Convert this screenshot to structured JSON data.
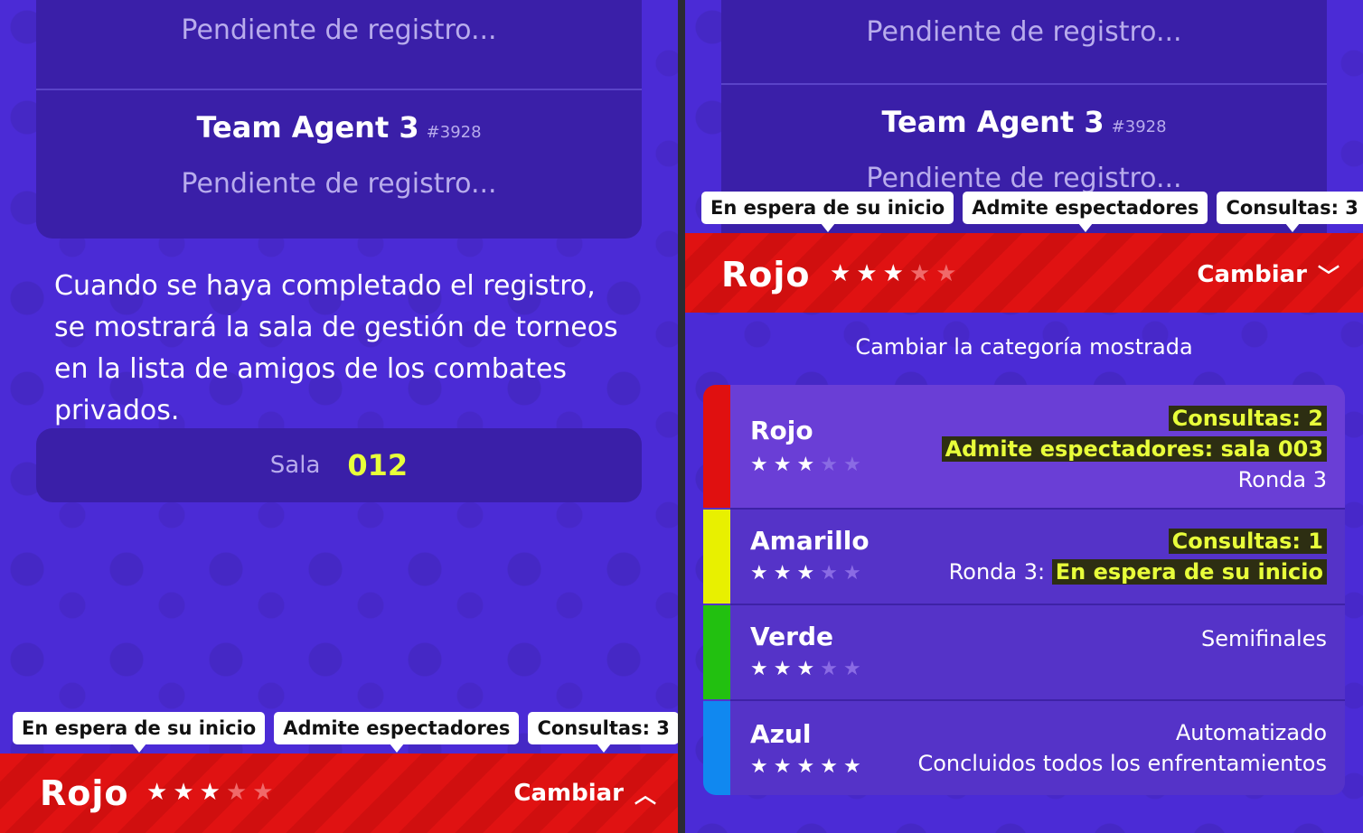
{
  "left": {
    "pending_1": "Pendiente de registro...",
    "team_name": "Team Agent 3",
    "team_code": "#3928",
    "pending_2": "Pendiente de registro...",
    "info": "Cuando se haya completado el registro, se mostrará la sala de gestión de torneos en la lista de amigos de los combates privados.",
    "sala_label": "Sala",
    "sala_value": "012",
    "tags": [
      "En espera de su inicio",
      "Admite espectadores",
      "Consultas: 3"
    ],
    "bar_team": "Rojo",
    "bar_stars": 3,
    "bar_stars_total": 5,
    "cambiar": "Cambiar",
    "cambiar_icon": "chevron-up-icon"
  },
  "right": {
    "pending_1": "Pendiente de registro...",
    "team_name": "Team Agent 3",
    "team_code": "#3928",
    "pending_2": "Pendiente de registro...",
    "tags": [
      "En espera de su inicio",
      "Admite espectadores",
      "Consultas: 3"
    ],
    "bar_team": "Rojo",
    "bar_stars": 3,
    "bar_stars_total": 5,
    "cambiar": "Cambiar",
    "cambiar_icon": "chevron-down-icon",
    "category_title": "Cambiar la categoría mostrada",
    "categories": [
      {
        "name": "Rojo",
        "color": "#e01010",
        "stars": 3,
        "line1": "Consultas: 2",
        "line2": "Admite espectadores: sala 003",
        "line3": "Ronda 3"
      },
      {
        "name": "Amarillo",
        "color": "#e8f000",
        "stars": 3,
        "line1": "Consultas: 1",
        "line2_prefix": "Ronda 3:",
        "line2": "En espera de su inicio"
      },
      {
        "name": "Verde",
        "color": "#22c010",
        "stars": 3,
        "line1": "Semifinales"
      },
      {
        "name": "Azul",
        "color": "#1088f0",
        "stars": 5,
        "line1": "Automatizado",
        "line2": "Concluidos todos los enfrentamientos"
      }
    ]
  },
  "colors": {
    "bg": "#4b2bd6",
    "card": "#3a1fa8",
    "accent_yellow": "#e8ff3a",
    "red": "#e01212"
  }
}
